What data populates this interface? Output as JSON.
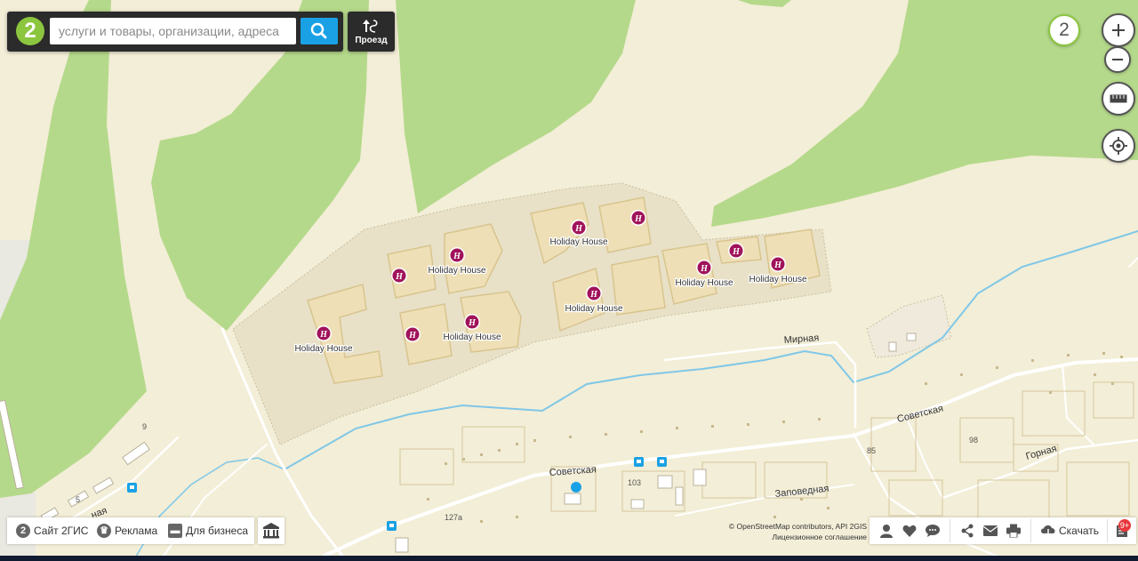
{
  "search": {
    "placeholder": "услуги и товары, организации, адреса"
  },
  "route_button": {
    "label": "Проезд"
  },
  "logo_text": "2",
  "floors_badge": "2",
  "map_labels": {
    "hotel_name": "Holiday House",
    "streets": {
      "mirnaya": "Мирная",
      "sovetskaya_east": "Советская",
      "sovetskaya_west": "Советская",
      "gornaya": "Горная",
      "zapovednaya": "Заповедная",
      "street_fragment": "ная"
    },
    "house_numbers": {
      "n103": "103",
      "n127a": "127а",
      "n85": "85",
      "n9": "9",
      "n5": "5",
      "n98": "98"
    }
  },
  "hotel_marker_symbol": "H",
  "bottom_left": {
    "site": "Сайт 2ГИС",
    "ads": "Реклама",
    "business": "Для бизнеса"
  },
  "attribution": {
    "line1": "© OpenStreetMap contributors, API 2GIS",
    "line2": "Лицензионное соглашение"
  },
  "bottom_right": {
    "download": "Скачать",
    "notification_count": "9+"
  },
  "colors": {
    "background": "#f3eed7",
    "forest": "#b5d98b",
    "territory": "#e8e1c7",
    "building": "#eedfb6",
    "water": "#7fc7e8",
    "accent": "#1aa1e5",
    "brand": "#8cc63f",
    "hotel_marker": "#a0135a"
  },
  "icons": [
    "search-icon",
    "route-icon",
    "plus-icon",
    "minus-icon",
    "ruler-icon",
    "locate-icon",
    "museum-icon",
    "user-icon",
    "heart-icon",
    "comment-icon",
    "share-icon",
    "mail-icon",
    "print-icon",
    "download-icon",
    "news-icon"
  ]
}
